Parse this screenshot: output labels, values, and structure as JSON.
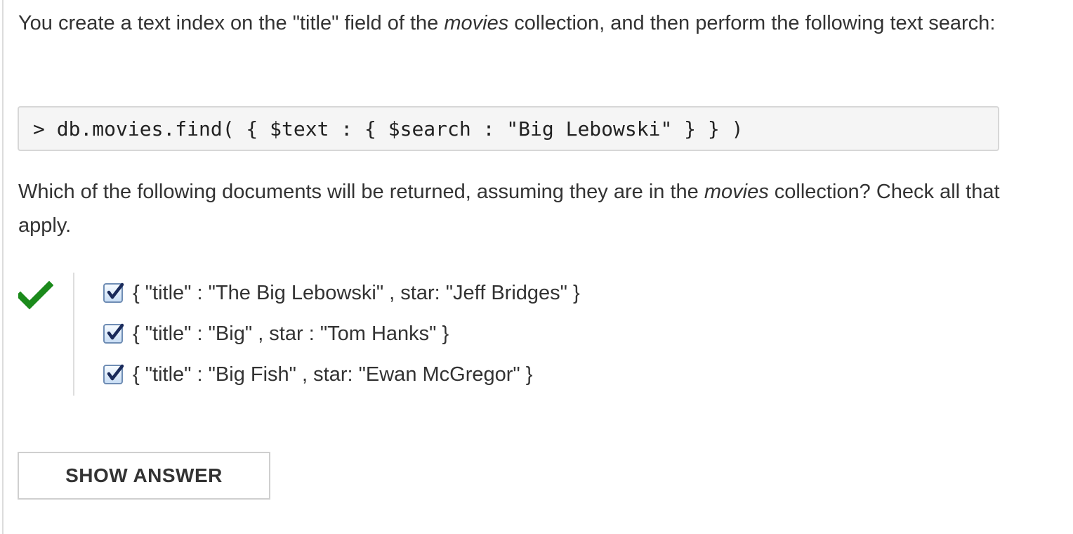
{
  "question": {
    "intro_before": "You create a text index on the \"title\" field of the ",
    "intro_collection": "movies",
    "intro_after": " collection, and then perform the following text search:",
    "code": "> db.movies.find( { $text : { $search : \"Big Lebowski\" } } )",
    "prompt_before": "Which of the following documents will be returned, assuming they are in the ",
    "prompt_collection": "movies",
    "prompt_after": " collection? Check all that apply."
  },
  "result": {
    "icon": "check-mark-icon",
    "status": "correct",
    "color": "#1b8a1b"
  },
  "options": [
    {
      "label": "{ \"title\" : \"The Big Lebowski\" , star: \"Jeff Bridges\" }",
      "checked": true
    },
    {
      "label": "{ \"title\" : \"Big\" , star : \"Tom Hanks\" }",
      "checked": true
    },
    {
      "label": "{ \"title\" : \"Big Fish\" , star: \"Ewan McGregor\" }",
      "checked": true
    }
  ],
  "actions": {
    "show_answer_label": "SHOW ANSWER"
  },
  "colors": {
    "text": "#333333",
    "code_background": "#f5f5f5",
    "code_border": "#d7d7d7",
    "checkbox_border": "#6f8db4",
    "checkmark": "#1a2a5a"
  }
}
